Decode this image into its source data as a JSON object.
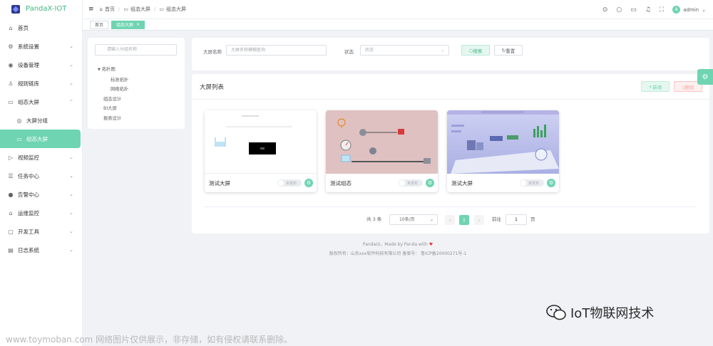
{
  "app": {
    "title": "PandaX-IOT"
  },
  "sidebar": {
    "items": [
      {
        "label": "首页",
        "icon": "home-icon",
        "arrow": ""
      },
      {
        "label": "系统设置",
        "icon": "gear-icon",
        "arrow": "⌄"
      },
      {
        "label": "设备管理",
        "icon": "signal-icon",
        "arrow": "⌄"
      },
      {
        "label": "规则链库",
        "icon": "user-icon",
        "arrow": "⌄"
      },
      {
        "label": "组态大屏",
        "icon": "monitor-icon",
        "arrow": "⌃"
      },
      {
        "label": "大屏分组",
        "icon": "circle-icon",
        "arrow": "",
        "sub": true
      },
      {
        "label": "组态大屏",
        "icon": "monitor-icon",
        "arrow": "",
        "sub": true,
        "active": true
      },
      {
        "label": "视频监控",
        "icon": "video-icon",
        "arrow": "⌄"
      },
      {
        "label": "任务中心",
        "icon": "task-icon",
        "arrow": "⌄"
      },
      {
        "label": "告警中心",
        "icon": "alarm-icon",
        "arrow": "⌄"
      },
      {
        "label": "运维监控",
        "icon": "ops-icon",
        "arrow": "⌄"
      },
      {
        "label": "开发工具",
        "icon": "tools-icon",
        "arrow": "⌄"
      },
      {
        "label": "日志系统",
        "icon": "log-icon",
        "arrow": "⌄"
      }
    ]
  },
  "header": {
    "breadcrumb": [
      "首页",
      "组态大屏",
      "组态大屏"
    ],
    "user": "admin",
    "avatar": "A"
  },
  "tags": [
    {
      "label": "首页",
      "active": false
    },
    {
      "label": "组态大屏",
      "active": true
    }
  ],
  "tree": {
    "placeholder": "请输入分组名称",
    "nodes": [
      "拓扑图",
      "标准拓扑",
      "网络拓扑",
      "组态设计",
      "BI大屏",
      "报表设计"
    ]
  },
  "search": {
    "name_label": "大屏名称",
    "name_placeholder": "大屏名称模糊查询",
    "status_label": "状态",
    "status_placeholder": "状态",
    "search_btn": "搜索",
    "reset_btn": "重置"
  },
  "list": {
    "title": "大屏列表",
    "add_btn": "新增",
    "delete_btn": "删除",
    "screens": [
      {
        "name": "测试大屏",
        "status": "未发布",
        "thumb": "blank"
      },
      {
        "name": "测试组态",
        "status": "未发布",
        "thumb": "scada"
      },
      {
        "name": "测试大屏",
        "status": "未发布",
        "thumb": "3d"
      }
    ]
  },
  "pagination": {
    "total": "共 3 条",
    "page_size": "10条/页",
    "current": "1",
    "goto_label": "前往",
    "goto_value": "1",
    "page_unit": "页"
  },
  "footer": {
    "line1": "PandaUi，Made by Panda with",
    "line2": "版权所有：山东xxx软件科技有限公司 备案号：  鲁ICP备20000271号-1"
  },
  "overlay": {
    "brand": "IoT物联网技术",
    "watermark": "www.toymoban.com 网络图片仅供展示，非存储，如有侵权请联系删除。"
  },
  "colors": {
    "accent": "#6fd4b1",
    "brand_text": "#41b883",
    "danger": "#f9a7a7"
  }
}
